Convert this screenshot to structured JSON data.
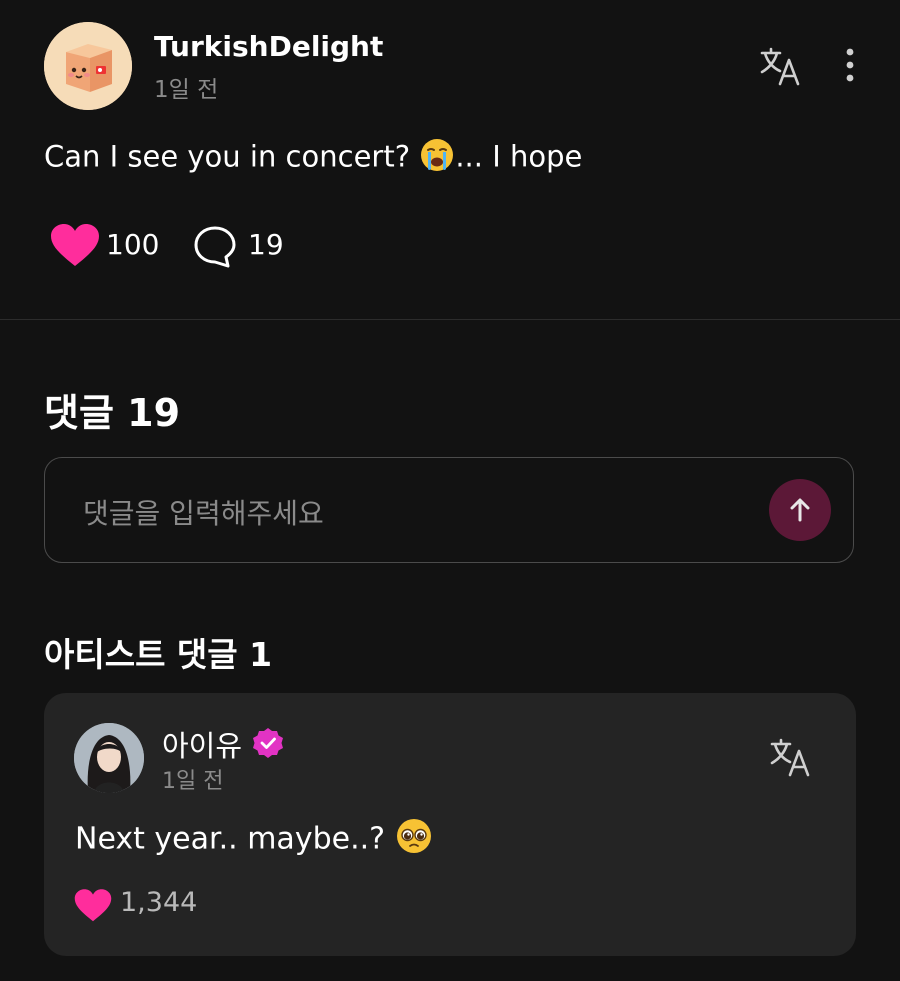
{
  "post": {
    "username": "TurkishDelight",
    "time": "1일 전",
    "text_before": "Can I see you in concert?",
    "text_after": "... I hope",
    "like_count": "100",
    "comment_count": "19",
    "colors": {
      "heart": "#ff2d9c",
      "background": "#121212"
    }
  },
  "comments": {
    "title": "댓글 19",
    "input_placeholder": "댓글을 입력해주세요"
  },
  "artist_section": {
    "title": "아티스트 댓글 1",
    "comment": {
      "name": "아이유",
      "time": "1일 전",
      "text": "Next year.. maybe..?",
      "like_count": "1,344"
    }
  }
}
